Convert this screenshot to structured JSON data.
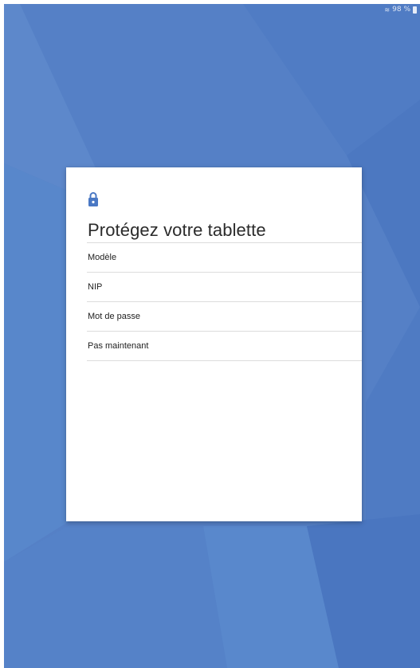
{
  "status_bar": {
    "battery_text": "98 %",
    "wifi_icon": "wifi-icon",
    "battery_icon": "battery-icon"
  },
  "colors": {
    "background": "#5580c6",
    "accent": "#4a78c4",
    "card": "#ffffff"
  },
  "dialog": {
    "icon": "lock-icon",
    "title": "Protégez votre tablette",
    "options": [
      {
        "label": "Modèle"
      },
      {
        "label": "NIP"
      },
      {
        "label": "Mot de passe"
      },
      {
        "label": "Pas maintenant"
      }
    ]
  }
}
